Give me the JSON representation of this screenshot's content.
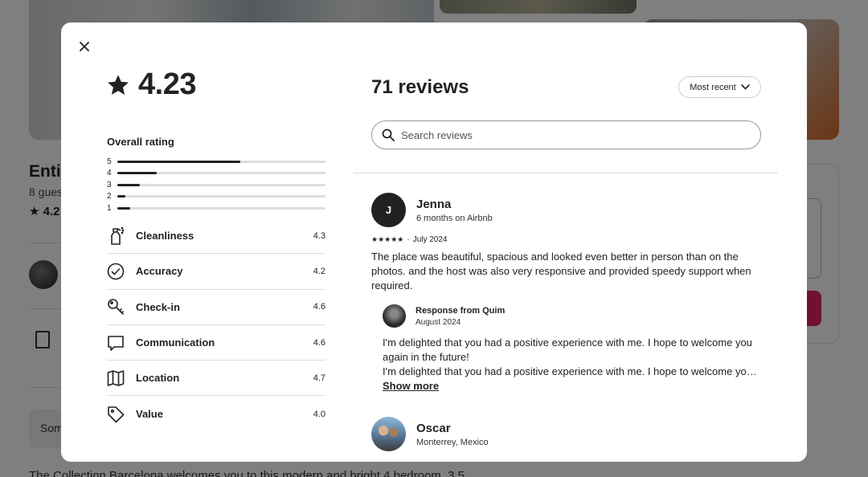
{
  "background": {
    "listing_title_fragment": "Enti",
    "guests_fragment": "8 gues",
    "rating_fragment": "4.2",
    "notice_fragment": "Som",
    "description_fragment": "The Collection Barcelona welcomes you to this modern and bright 4 bedroom, 3.5"
  },
  "modal": {
    "overall_score": "4.23",
    "overall_rating_label": "Overall rating",
    "rating_distribution": [
      {
        "stars": "5",
        "fraction": 0.59
      },
      {
        "stars": "4",
        "fraction": 0.19
      },
      {
        "stars": "3",
        "fraction": 0.11
      },
      {
        "stars": "2",
        "fraction": 0.04
      },
      {
        "stars": "1",
        "fraction": 0.06
      }
    ],
    "categories": [
      {
        "label": "Cleanliness",
        "value": "4.3",
        "icon": "spray-bottle-icon"
      },
      {
        "label": "Accuracy",
        "value": "4.2",
        "icon": "check-circle-icon"
      },
      {
        "label": "Check-in",
        "value": "4.6",
        "icon": "key-icon"
      },
      {
        "label": "Communication",
        "value": "4.6",
        "icon": "chat-bubble-icon"
      },
      {
        "label": "Location",
        "value": "4.7",
        "icon": "map-icon"
      },
      {
        "label": "Value",
        "value": "4.0",
        "icon": "tag-icon"
      }
    ],
    "reviews_title": "71 reviews",
    "sort_label": "Most recent",
    "search_placeholder": "Search reviews",
    "reviews": [
      {
        "initial": "J",
        "name": "Jenna",
        "meta": "6 months on Airbnb",
        "stars": "★★★★★",
        "date": "July 2024",
        "text": "The place was beautiful, spacious and looked even better in person than on the photos. and the host was also very responsive and provided speedy support when required.",
        "response": {
          "from": "Response from Quim",
          "date": "August 2024",
          "text_line1": "I'm delighted that you had a positive experience with me. I hope to welcome you again in the future!",
          "text_line2": "I'm delighted that you had a positive experience with me. I hope to welcome you again in the future!",
          "show_more": "Show more"
        }
      },
      {
        "name": "Oscar",
        "meta": "Monterrey, Mexico"
      }
    ]
  }
}
